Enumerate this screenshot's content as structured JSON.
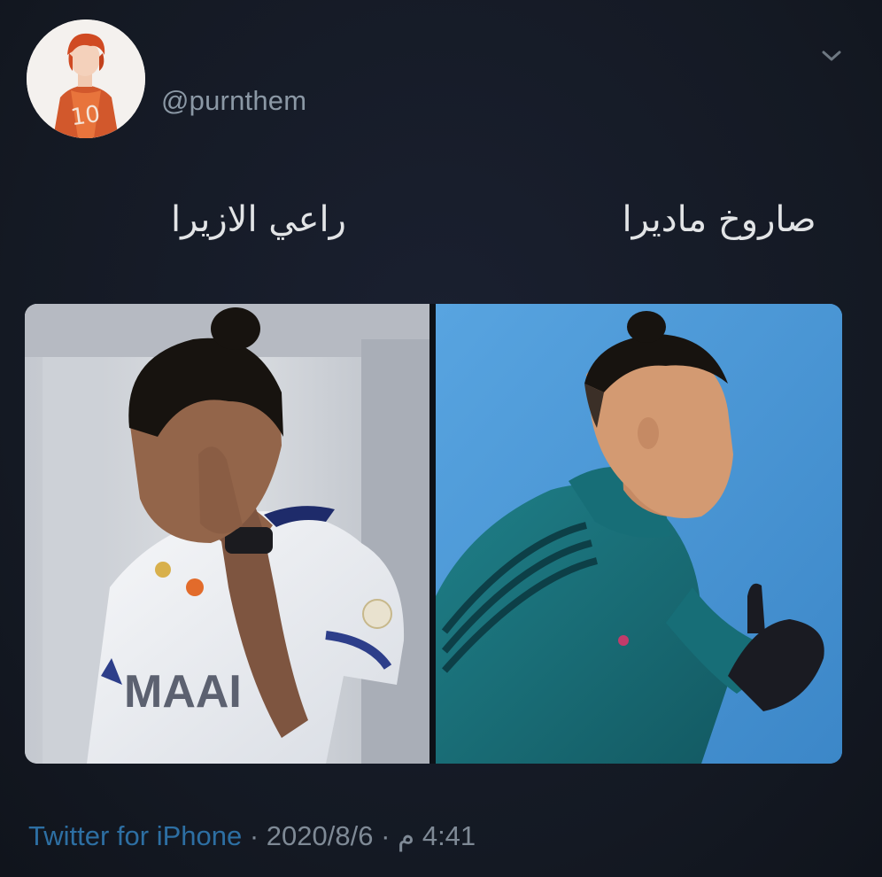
{
  "tweet": {
    "handle": "@purnthem",
    "caption_left": "راعي الازيرا",
    "caption_right": "صاروخ ماديرا",
    "source": "Twitter for iPhone",
    "separator": " · ",
    "date": "2020/8/6",
    "time": "4:41 م"
  },
  "icons": {
    "avatar": "avatar-image",
    "menu": "chevron-down-icon"
  },
  "colors": {
    "background": "#141923",
    "handle": "#8b98a5",
    "link": "#2d6fa3",
    "caption": "#e2e4e6"
  }
}
